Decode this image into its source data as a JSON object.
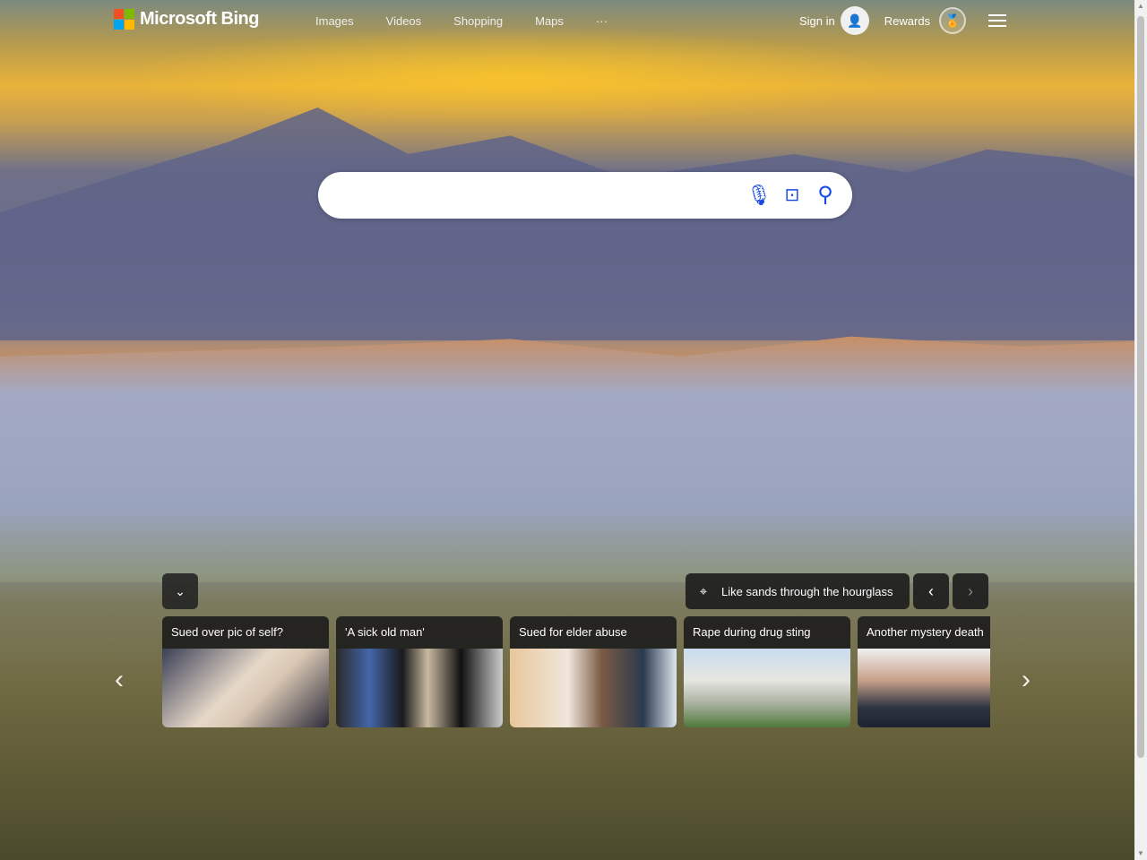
{
  "header": {
    "logo": "Microsoft Bing",
    "nav": [
      "Images",
      "Videos",
      "Shopping",
      "Maps"
    ],
    "more": "···",
    "sign_in": "Sign in",
    "rewards": "Rewards"
  },
  "search": {
    "value": "",
    "placeholder": ""
  },
  "image_info": {
    "title": "Like sands through the hourglass"
  },
  "news": [
    {
      "title": "Sued over pic of self?",
      "img": "linear-gradient(135deg,#3a3f55,#e6d8c8 45%,#d9c7b4 60%,#2c2c3a)"
    },
    {
      "title": "'A sick old man'",
      "img": "linear-gradient(90deg,#2a2a2a,#4466aa 20%,#1a1a1a 40%,#c9b9a0 55%,#111 75%,#cccccc)"
    },
    {
      "title": "Sued for elder abuse",
      "img": "linear-gradient(90deg,#e8c79a,#f0e6dc 35%,#7a5a44 55%,#2b3a4e 80%,#dde6ee)"
    },
    {
      "title": "Rape during drug sting",
      "img": "linear-gradient(180deg,#c9dcee,#e6e6e0 40%,#a8b0a0 70%,#4f7a3a)"
    },
    {
      "title": "Another mystery death",
      "img": "linear-gradient(180deg,#f0f0f0,#c9a08a 40%,#2c3442 75%,#1d2430)"
    }
  ]
}
